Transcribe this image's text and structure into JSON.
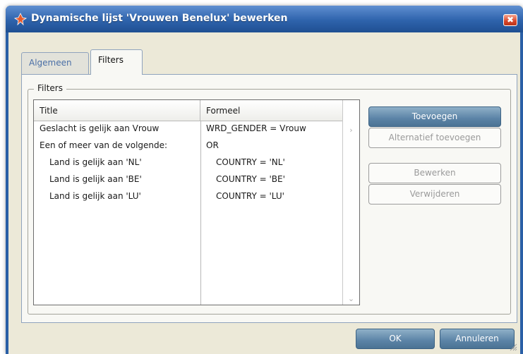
{
  "window": {
    "title": "Dynamische lijst 'Vrouwen Benelux' bewerken",
    "close_glyph": "✖"
  },
  "tabs": [
    {
      "label": "Algemeen",
      "active": false
    },
    {
      "label": "Filters",
      "active": true
    }
  ],
  "filters_group": {
    "legend": "Filters",
    "table": {
      "columns": [
        "Title",
        "Formeel"
      ],
      "rows": [
        {
          "title": "Geslacht is gelijk aan Vrouw",
          "formula": "WRD_GENDER = Vrouw",
          "indent": false
        },
        {
          "title": "Een of meer van de volgende:",
          "formula": "OR",
          "indent": false
        },
        {
          "title": "Land is gelijk aan 'NL'",
          "formula": "COUNTRY = 'NL'",
          "indent": true
        },
        {
          "title": "Land is gelijk aan 'BE'",
          "formula": "COUNTRY = 'BE'",
          "indent": true
        },
        {
          "title": "Land is gelijk aan 'LU'",
          "formula": "COUNTRY = 'LU'",
          "indent": true
        }
      ]
    },
    "buttons": {
      "add": "Toevoegen",
      "add_alternative": "Alternatief toevoegen",
      "edit": "Bewerken",
      "delete": "Verwijderen"
    }
  },
  "footer": {
    "ok": "OK",
    "cancel": "Annuleren"
  },
  "icons": {
    "app": "app-icon",
    "close": "close-icon",
    "scroll_up": "chevron-up-icon",
    "scroll_down": "chevron-down-icon",
    "resize": "resize-grip-icon"
  },
  "colors": {
    "titlebar": "#2e63ac",
    "client_background": "#ece9d8",
    "primary_button": "#5b83a6",
    "close_button": "#d8452a"
  }
}
